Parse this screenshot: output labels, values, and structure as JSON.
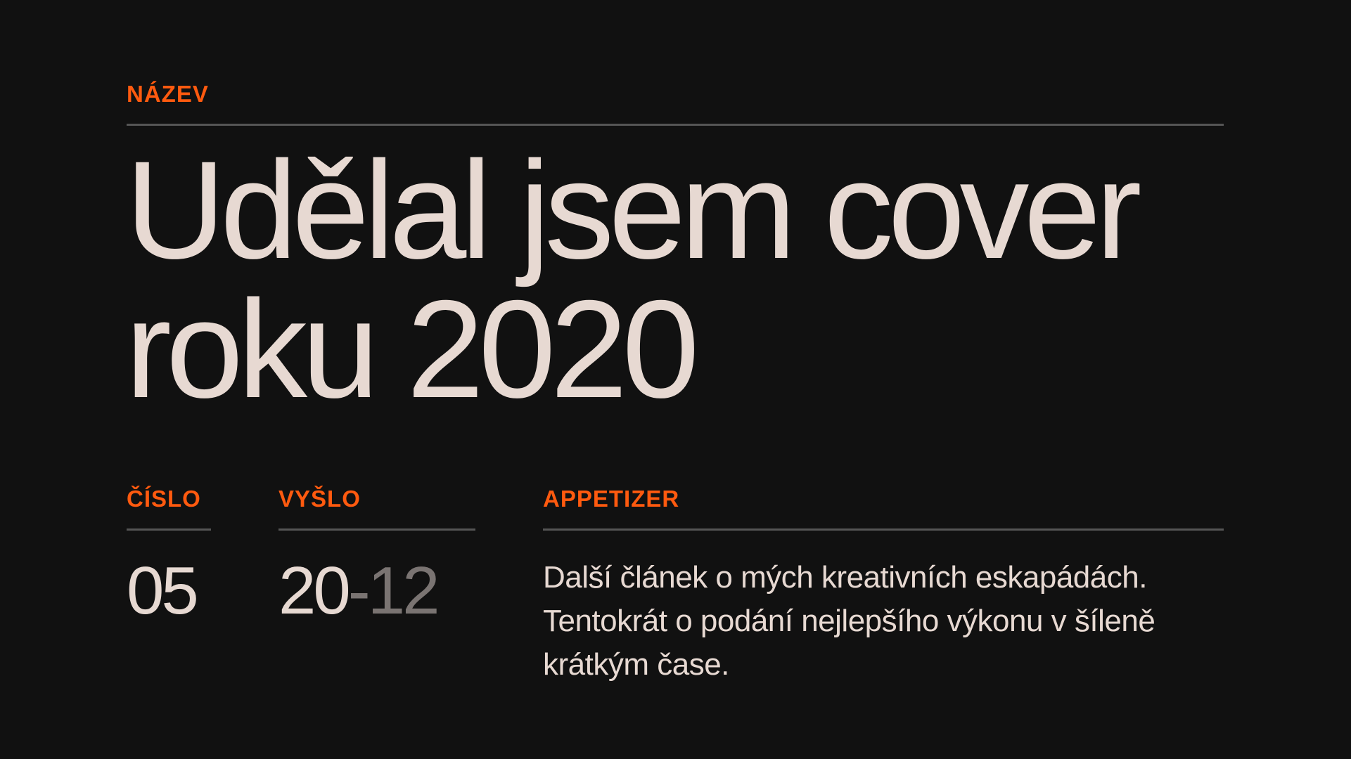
{
  "header": {
    "label": "NÁZEV",
    "title_line1": "Udělal jsem cover",
    "title_line2": "roku 2020"
  },
  "meta": {
    "issue_label": "ČÍSLO",
    "issue_value": "05",
    "released_label": "VYŠLO",
    "released_year": "20",
    "released_separator": "-",
    "released_month": "12",
    "appetizer_label": "APPETIZER",
    "appetizer_text": "Další článek o mých kreativních eskapádách. Tentokrát o podání nejlepšího výkonu v šíleně krátkým čase."
  },
  "colors": {
    "background": "#111111",
    "accent": "#ff5a0f",
    "text": "#e7d9d2",
    "muted": "#7a7472",
    "rule": "#555555"
  }
}
